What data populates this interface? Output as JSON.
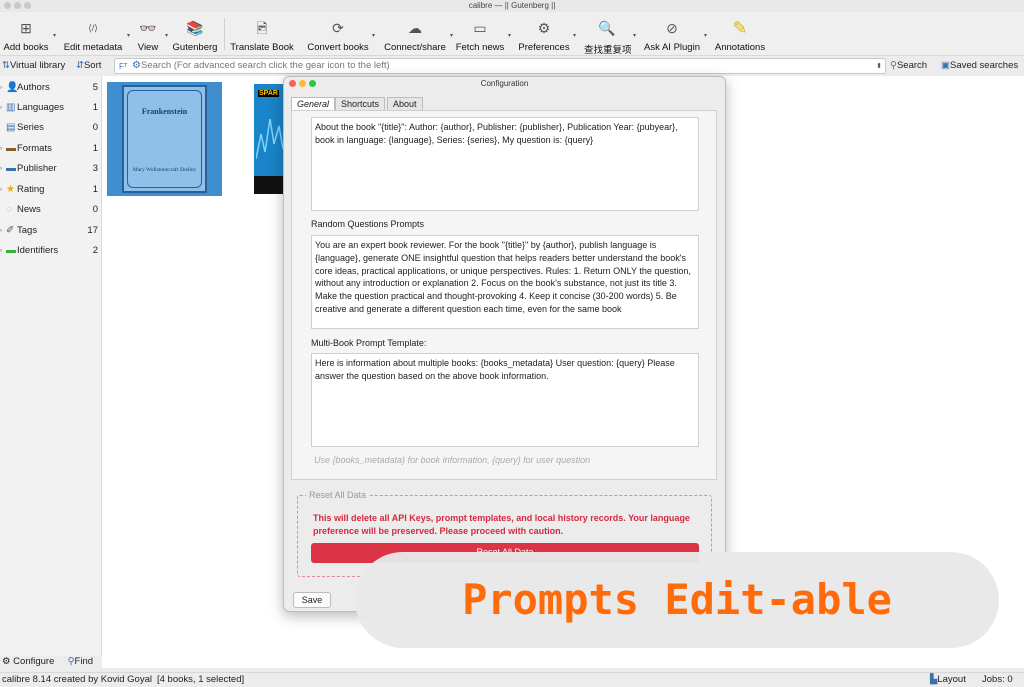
{
  "window": {
    "title": "calibre — || Gutenberg ||"
  },
  "toolbar": {
    "items": [
      {
        "label": "Add books",
        "icon": "add-books-icon",
        "glyph": "⊞"
      },
      {
        "label": "Edit metadata",
        "icon": "edit-metadata-icon",
        "glyph": "⟨/⟩"
      },
      {
        "label": "View",
        "icon": "glasses-icon",
        "glyph": "👓"
      },
      {
        "label": "Gutenberg",
        "icon": "library-books-icon",
        "glyph": "📚"
      },
      {
        "label": "Translate Book",
        "icon": "translate-icon",
        "glyph": "🖻"
      },
      {
        "label": "Convert books",
        "icon": "convert-icon",
        "glyph": "⟳"
      },
      {
        "label": "Connect/share",
        "icon": "cloud-icon",
        "glyph": "☁"
      },
      {
        "label": "Fetch news",
        "icon": "news-icon",
        "glyph": "▭"
      },
      {
        "label": "Preferences",
        "icon": "gear-icon",
        "glyph": "⚙"
      },
      {
        "label": "查找重复项",
        "icon": "find-duplicates-icon",
        "glyph": "🔍"
      },
      {
        "label": "Ask AI Plugin",
        "icon": "ai-plugin-icon",
        "glyph": "⊘"
      },
      {
        "label": "Annotations",
        "icon": "highlighter-icon",
        "glyph": "✎"
      }
    ]
  },
  "searchbar": {
    "virtual_library": "Virtual library",
    "sort": "Sort",
    "placeholder": "Search (For advanced search click the gear icon to the left)",
    "search": "Search",
    "saved_searches": "Saved searches"
  },
  "sidebar": {
    "items": [
      {
        "label": "Authors",
        "count": "5",
        "icon": "person-icon",
        "glyph": "👤"
      },
      {
        "label": "Languages",
        "count": "1",
        "icon": "languages-icon",
        "glyph": "▥"
      },
      {
        "label": "Series",
        "count": "0",
        "icon": "series-icon",
        "glyph": "▤"
      },
      {
        "label": "Formats",
        "count": "1",
        "icon": "formats-icon",
        "glyph": "▬"
      },
      {
        "label": "Publisher",
        "count": "3",
        "icon": "publisher-icon",
        "glyph": "▬"
      },
      {
        "label": "Rating",
        "count": "1",
        "icon": "star-icon",
        "glyph": "★"
      },
      {
        "label": "News",
        "count": "0",
        "icon": "news-icon",
        "glyph": "◌"
      },
      {
        "label": "Tags",
        "count": "17",
        "icon": "tag-icon",
        "glyph": "✐"
      },
      {
        "label": "Identifiers",
        "count": "2",
        "icon": "identifiers-icon",
        "glyph": "▬"
      }
    ],
    "configure": "Configure",
    "find": "Find"
  },
  "books": {
    "book1": {
      "title": "Frankenstein",
      "author": "Mary Wollstonecraft Shelley"
    },
    "book2": {
      "tag": "SPAR"
    }
  },
  "dialog": {
    "title": "Configuration",
    "tabs": [
      "General",
      "Shortcuts",
      "About"
    ],
    "active_tab": "General",
    "book_prompt": "About the book \"{title}\": Author: {author}, Publisher: {publisher}, Publication Year: {pubyear}, book in language: {language}, Series: {series}, My question is: {query}",
    "random_label": "Random Questions Prompts",
    "random_prompt": "You are an expert book reviewer. For the book \"{title}\" by {author}, publish language is {language}, generate ONE insightful question that helps readers better understand the book's core ideas, practical applications, or unique perspectives. Rules: 1. Return ONLY the question, without any introduction or explanation 2. Focus on the book's substance, not just its title 3. Make the question practical and thought-provoking 4. Keep it concise (30-200 words) 5. Be creative and generate a different question each time, even for the same book",
    "multi_label": "Multi-Book Prompt Template:",
    "multi_prompt": "Here is information about multiple books: {books_metadata} User question: {query} Please answer the question based on the above book information.",
    "multi_hint": "Use {books_metadata} for book information, {query} for user question",
    "reset_group": "Reset All Data",
    "reset_warning": "This will delete all API Keys, prompt templates, and local history records. Your language preference will be preserved. Please proceed with caution.",
    "reset_button": "Reset All Data",
    "save": "Save"
  },
  "statusbar": {
    "left": "calibre 8.14 created by Kovid Goyal",
    "books": "[4 books, 1 selected]",
    "layout": "Layout",
    "jobs": "Jobs: 0"
  },
  "banner": {
    "text": "Prompts Edit-able"
  },
  "colors": {
    "accent_red": "#dd3347",
    "banner_orange": "#ff6a0a",
    "dialog_bg": "#ececec"
  }
}
